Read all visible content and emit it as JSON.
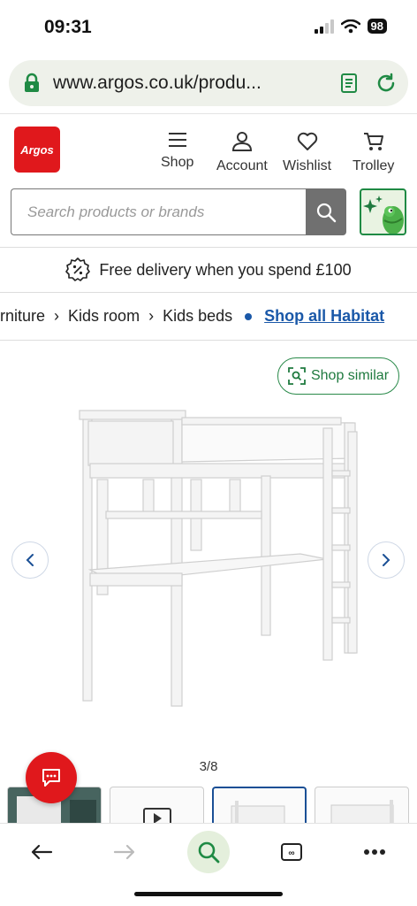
{
  "status_bar": {
    "time": "09:31",
    "battery": "98"
  },
  "browser": {
    "url": "www.argos.co.uk/produ..."
  },
  "header": {
    "logo_text": "Argos",
    "nav": [
      {
        "label": "Shop",
        "icon": "menu-icon"
      },
      {
        "label": "Account",
        "icon": "person-icon"
      },
      {
        "label": "Wishlist",
        "icon": "heart-icon"
      },
      {
        "label": "Trolley",
        "icon": "trolley-icon"
      }
    ],
    "search_placeholder": "Search products or brands"
  },
  "delivery_banner": {
    "text": "Free delivery when you spend £100"
  },
  "breadcrumb": {
    "items": [
      "rniture",
      "Kids room",
      "Kids beds"
    ],
    "link": "Shop all Habitat"
  },
  "gallery": {
    "shop_similar": "Shop similar",
    "counter": "3/8"
  },
  "colors": {
    "brand_red": "#e0181c",
    "link_blue": "#1a58a8",
    "accent_green": "#1f8a44"
  }
}
